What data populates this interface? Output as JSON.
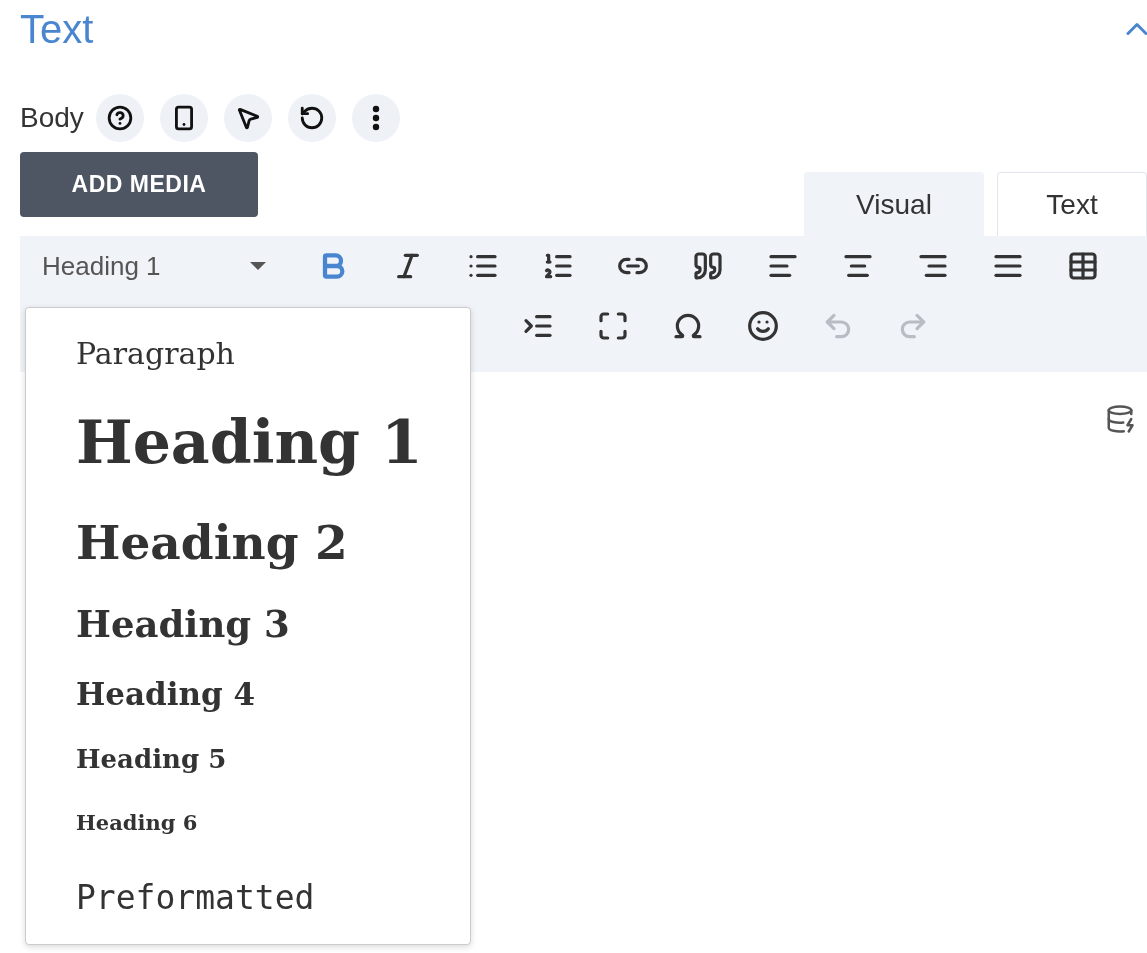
{
  "section": {
    "title": "Text",
    "expanded": true
  },
  "field": {
    "label": "Body",
    "actions": [
      {
        "kind": "help"
      },
      {
        "kind": "device"
      },
      {
        "kind": "pointer"
      },
      {
        "kind": "reset"
      },
      {
        "kind": "more"
      }
    ]
  },
  "add_media": {
    "label": "ADD MEDIA"
  },
  "tabs": [
    {
      "label": "Visual",
      "selected": true
    },
    {
      "label": "Text",
      "selected": false
    }
  ],
  "toolbar": {
    "format_select": {
      "value": "Heading 1",
      "expanded": true
    },
    "row_1": [
      {
        "kind": "bold",
        "active": true
      },
      {
        "kind": "italic",
        "active": false
      },
      {
        "kind": "bullet-list",
        "active": false
      },
      {
        "kind": "numbered-list",
        "active": false
      },
      {
        "kind": "link",
        "active": false
      },
      {
        "kind": "quote",
        "active": false
      },
      {
        "kind": "align-left",
        "active": false
      },
      {
        "kind": "align-center",
        "active": false
      },
      {
        "kind": "align-right",
        "active": false
      },
      {
        "kind": "justify",
        "active": false
      },
      {
        "kind": "table",
        "active": false
      }
    ],
    "row_2": [
      {
        "kind": "indent",
        "disabled": false
      },
      {
        "kind": "fullscreen",
        "disabled": false
      },
      {
        "kind": "special-character",
        "disabled": false
      },
      {
        "kind": "emoji",
        "disabled": false
      },
      {
        "kind": "undo",
        "disabled": true
      },
      {
        "kind": "redo",
        "disabled": true
      }
    ]
  },
  "format_menu": [
    {
      "kind": "paragraph",
      "label": "Paragraph"
    },
    {
      "kind": "h1",
      "label": "Heading 1"
    },
    {
      "kind": "h2",
      "label": "Heading 2"
    },
    {
      "kind": "h3",
      "label": "Heading 3"
    },
    {
      "kind": "h4",
      "label": "Heading 4"
    },
    {
      "kind": "h5",
      "label": "Heading 5"
    },
    {
      "kind": "h6",
      "label": "Heading 6"
    },
    {
      "kind": "pre",
      "label": "Preformatted"
    }
  ]
}
